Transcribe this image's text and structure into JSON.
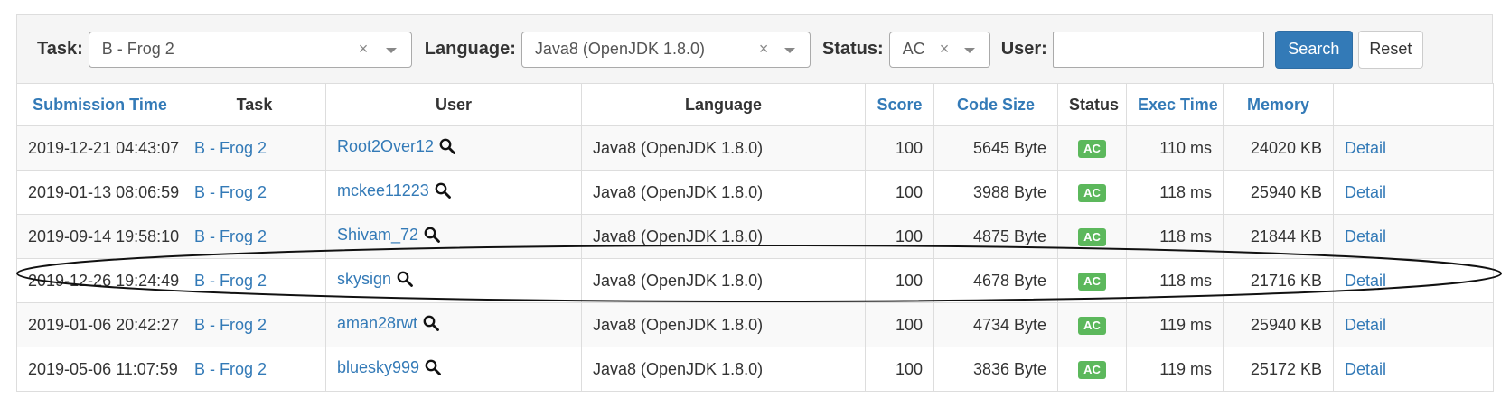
{
  "filters": {
    "task_label": "Task:",
    "task_value": "B - Frog 2",
    "language_label": "Language:",
    "language_value": "Java8 (OpenJDK 1.8.0)",
    "status_label": "Status:",
    "status_value": "AC",
    "user_label": "User:",
    "user_value": "",
    "clear_glyph": "×",
    "search_label": "Search",
    "reset_label": "Reset"
  },
  "table": {
    "headers": [
      "Submission Time",
      "Task",
      "User",
      "Language",
      "Score",
      "Code Size",
      "Status",
      "Exec Time",
      "Memory",
      ""
    ],
    "rows": [
      {
        "time": "2019-12-21 04:43:07",
        "task": "B - Frog 2",
        "user": "Root2Over12",
        "language": "Java8 (OpenJDK 1.8.0)",
        "score": "100",
        "code_size": "5645 Byte",
        "status": "AC",
        "exec_time": "110 ms",
        "memory": "24020 KB",
        "detail": "Detail"
      },
      {
        "time": "2019-01-13 08:06:59",
        "task": "B - Frog 2",
        "user": "mckee11223",
        "language": "Java8 (OpenJDK 1.8.0)",
        "score": "100",
        "code_size": "3988 Byte",
        "status": "AC",
        "exec_time": "118 ms",
        "memory": "25940 KB",
        "detail": "Detail"
      },
      {
        "time": "2019-09-14 19:58:10",
        "task": "B - Frog 2",
        "user": "Shivam_72",
        "language": "Java8 (OpenJDK 1.8.0)",
        "score": "100",
        "code_size": "4875 Byte",
        "status": "AC",
        "exec_time": "118 ms",
        "memory": "21844 KB",
        "detail": "Detail"
      },
      {
        "time": "2019-12-26 19:24:49",
        "task": "B - Frog 2",
        "user": "skysign",
        "language": "Java8 (OpenJDK 1.8.0)",
        "score": "100",
        "code_size": "4678 Byte",
        "status": "AC",
        "exec_time": "118 ms",
        "memory": "21716 KB",
        "detail": "Detail"
      },
      {
        "time": "2019-01-06 20:42:27",
        "task": "B - Frog 2",
        "user": "aman28rwt",
        "language": "Java8 (OpenJDK 1.8.0)",
        "score": "100",
        "code_size": "4734 Byte",
        "status": "AC",
        "exec_time": "119 ms",
        "memory": "25940 KB",
        "detail": "Detail"
      },
      {
        "time": "2019-05-06 11:07:59",
        "task": "B - Frog 2",
        "user": "bluesky999",
        "language": "Java8 (OpenJDK 1.8.0)",
        "score": "100",
        "code_size": "3836 Byte",
        "status": "AC",
        "exec_time": "119 ms",
        "memory": "25172 KB",
        "detail": "Detail"
      }
    ]
  },
  "colors": {
    "link": "#337ab7",
    "badge_ac": "#5cb85c",
    "primary_button": "#337ab7"
  }
}
